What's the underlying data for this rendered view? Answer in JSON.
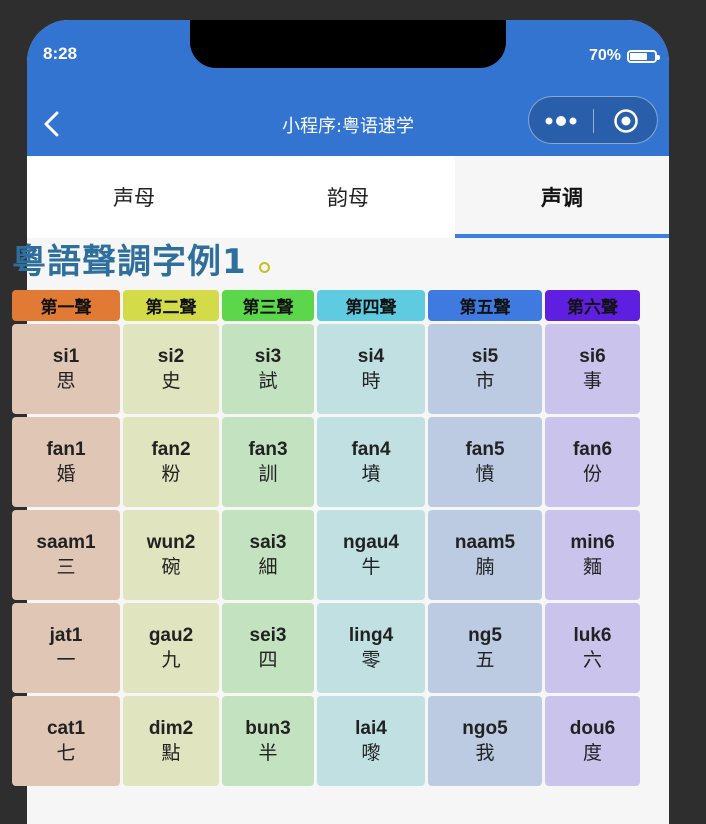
{
  "status": {
    "time": "8:28",
    "battery": "70%",
    "battery_level": 0.7
  },
  "nav": {
    "title": "小程序:粤语速学"
  },
  "tabs": [
    {
      "label": "声母",
      "active": false
    },
    {
      "label": "韵母",
      "active": false
    },
    {
      "label": "声调",
      "active": true
    }
  ],
  "heading": "粵語聲調字例1",
  "tone_headers": [
    {
      "label": "第一聲",
      "color": "#e07a34"
    },
    {
      "label": "第二聲",
      "color": "#d3dc48"
    },
    {
      "label": "第三聲",
      "color": "#5cd64a"
    },
    {
      "label": "第四聲",
      "color": "#5fcbe0"
    },
    {
      "label": "第五聲",
      "color": "#3e7ae0"
    },
    {
      "label": "第六聲",
      "color": "#5f1fe0"
    }
  ],
  "cell_colors": [
    "#e0c7b5",
    "#e0e4bf",
    "#c2e2c0",
    "#c0e0e2",
    "#bccbe1",
    "#cac4ed"
  ],
  "rows": [
    [
      {
        "rom": "si1",
        "chr": "思"
      },
      {
        "rom": "si2",
        "chr": "史"
      },
      {
        "rom": "si3",
        "chr": "試"
      },
      {
        "rom": "si4",
        "chr": "時"
      },
      {
        "rom": "si5",
        "chr": "市"
      },
      {
        "rom": "si6",
        "chr": "事"
      }
    ],
    [
      {
        "rom": "fan1",
        "chr": "婚"
      },
      {
        "rom": "fan2",
        "chr": "粉"
      },
      {
        "rom": "fan3",
        "chr": "訓"
      },
      {
        "rom": "fan4",
        "chr": "墳"
      },
      {
        "rom": "fan5",
        "chr": "憤"
      },
      {
        "rom": "fan6",
        "chr": "份"
      }
    ],
    [
      {
        "rom": "saam1",
        "chr": "三"
      },
      {
        "rom": "wun2",
        "chr": "碗"
      },
      {
        "rom": "sai3",
        "chr": "細"
      },
      {
        "rom": "ngau4",
        "chr": "牛"
      },
      {
        "rom": "naam5",
        "chr": "腩"
      },
      {
        "rom": "min6",
        "chr": "麵"
      }
    ],
    [
      {
        "rom": "jat1",
        "chr": "一"
      },
      {
        "rom": "gau2",
        "chr": "九"
      },
      {
        "rom": "sei3",
        "chr": "四"
      },
      {
        "rom": "ling4",
        "chr": "零"
      },
      {
        "rom": "ng5",
        "chr": "五"
      },
      {
        "rom": "luk6",
        "chr": "六"
      }
    ],
    [
      {
        "rom": "cat1",
        "chr": "七"
      },
      {
        "rom": "dim2",
        "chr": "點"
      },
      {
        "rom": "bun3",
        "chr": "半"
      },
      {
        "rom": "lai4",
        "chr": "嚟"
      },
      {
        "rom": "ngo5",
        "chr": "我"
      },
      {
        "rom": "dou6",
        "chr": "度"
      }
    ]
  ]
}
